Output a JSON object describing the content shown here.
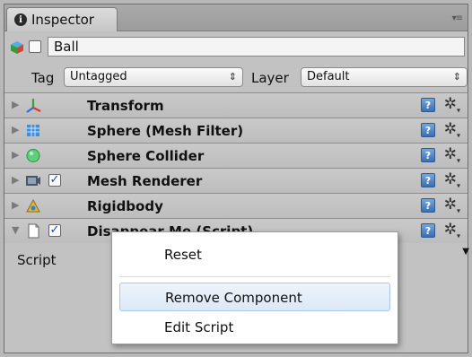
{
  "tab": {
    "label": "Inspector",
    "info_icon": "i",
    "menu_glyph": "▾≡"
  },
  "object": {
    "name": "Ball",
    "active": false
  },
  "tag": {
    "label": "Tag",
    "value": "Untagged"
  },
  "layer": {
    "label": "Layer",
    "value": "Default"
  },
  "components": [
    {
      "name": "Transform",
      "icon": "transform-axes-icon",
      "has_checkbox": false
    },
    {
      "name": "Sphere (Mesh Filter)",
      "icon": "mesh-filter-icon",
      "has_checkbox": false
    },
    {
      "name": "Sphere Collider",
      "icon": "sphere-collider-icon",
      "has_checkbox": false
    },
    {
      "name": "Mesh Renderer",
      "icon": "mesh-renderer-icon",
      "has_checkbox": true,
      "checked": true
    },
    {
      "name": "Rigidbody",
      "icon": "rigidbody-icon",
      "has_checkbox": false
    },
    {
      "name": "Disappear Me (Script)",
      "icon": "script-file-icon",
      "has_checkbox": true,
      "checked": true
    }
  ],
  "script_field": {
    "label": "Script"
  },
  "context_menu": {
    "items": [
      "Reset",
      "Remove Component",
      "Edit Script"
    ],
    "highlighted": "Remove Component"
  },
  "colors": {
    "help_icon": "#3c6fb0",
    "menu_highlight": "#dbe8f6"
  }
}
